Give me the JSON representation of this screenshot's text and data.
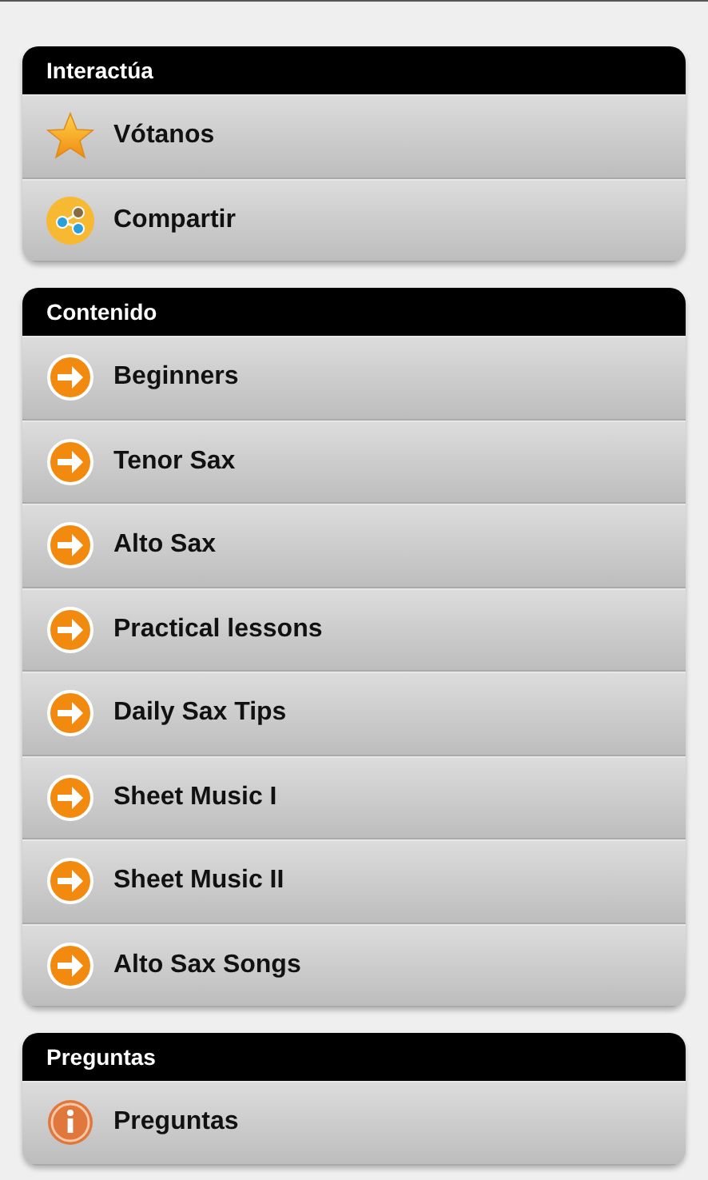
{
  "sections": [
    {
      "title": "Interactúa",
      "items": [
        {
          "label": "Vótanos",
          "kind": "star"
        },
        {
          "label": "Compartir",
          "kind": "share"
        }
      ]
    },
    {
      "title": "Contenido",
      "items": [
        {
          "label": "Beginners",
          "kind": "arrow"
        },
        {
          "label": "Tenor Sax",
          "kind": "arrow"
        },
        {
          "label": "Alto Sax",
          "kind": "arrow"
        },
        {
          "label": "Practical lessons",
          "kind": "arrow"
        },
        {
          "label": "Daily Sax Tips",
          "kind": "arrow"
        },
        {
          "label": "Sheet Music I",
          "kind": "arrow"
        },
        {
          "label": "Sheet Music II",
          "kind": "arrow"
        },
        {
          "label": "Alto Sax Songs",
          "kind": "arrow"
        }
      ]
    },
    {
      "title": "Preguntas",
      "items": [
        {
          "label": "Preguntas",
          "kind": "info"
        }
      ]
    }
  ]
}
